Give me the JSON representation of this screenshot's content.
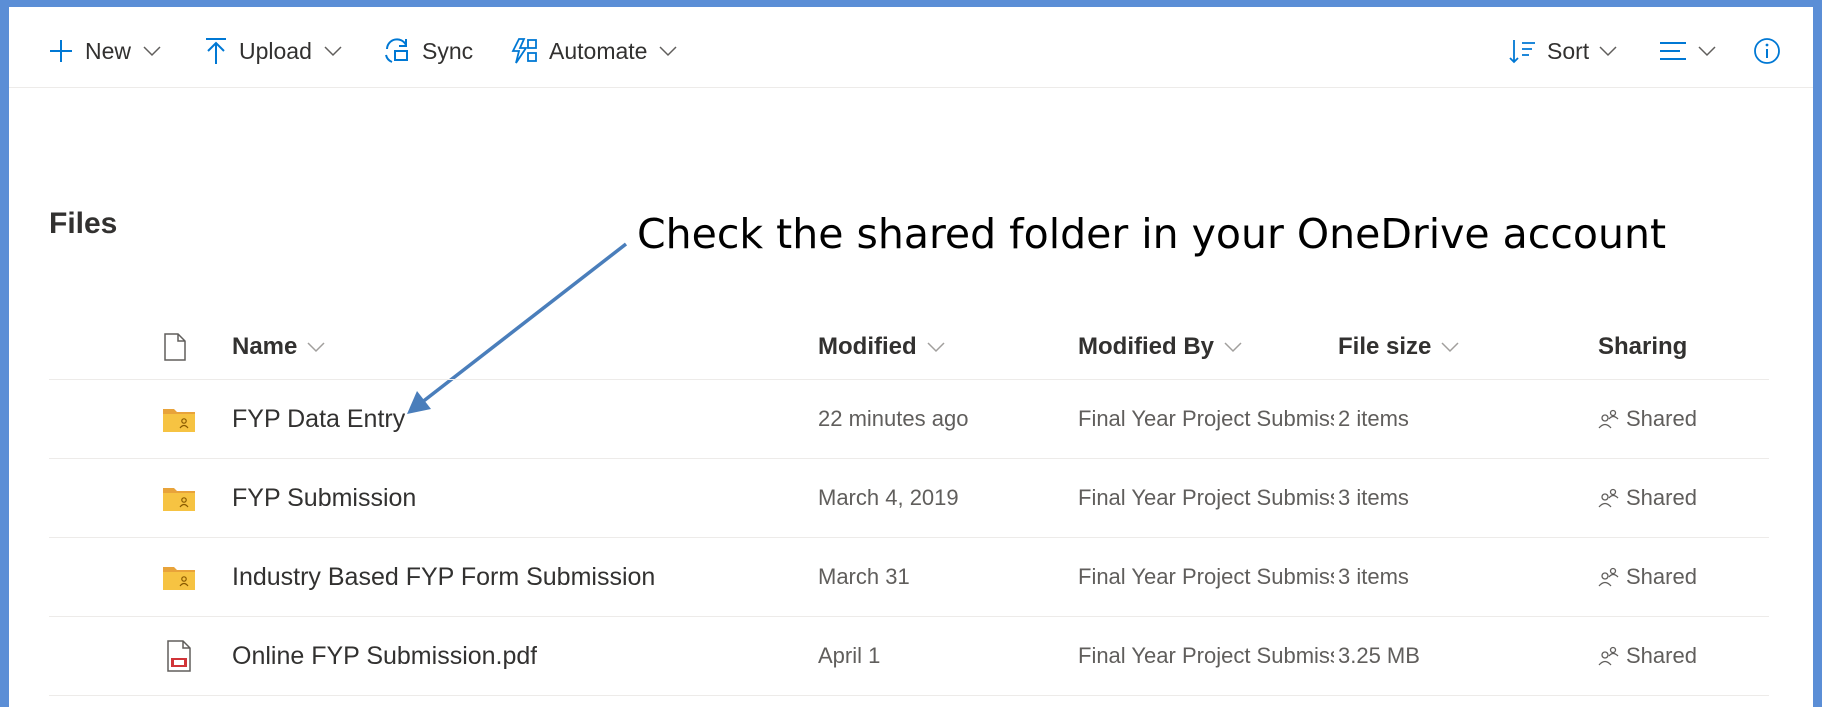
{
  "toolbar": {
    "new_label": "New",
    "upload_label": "Upload",
    "sync_label": "Sync",
    "automate_label": "Automate",
    "sort_label": "Sort"
  },
  "page": {
    "title": "Files",
    "annotation": "Check the shared folder in your OneDrive account"
  },
  "columns": {
    "name": "Name",
    "modified": "Modified",
    "modified_by": "Modified By",
    "file_size": "File size",
    "sharing": "Sharing"
  },
  "files": [
    {
      "type": "shared-folder",
      "name": "FYP Data Entry",
      "modified": "22 minutes ago",
      "modified_by": "Final Year Project Submissi",
      "size": "2 items",
      "sharing": "Shared",
      "new": true
    },
    {
      "type": "shared-folder",
      "name": "FYP Submission",
      "modified": "March 4, 2019",
      "modified_by": "Final Year Project Submissi",
      "size": "3 items",
      "sharing": "Shared",
      "new": false
    },
    {
      "type": "shared-folder",
      "name": "Industry Based FYP Form Submission",
      "modified": "March 31",
      "modified_by": "Final Year Project Submissi",
      "size": "3 items",
      "sharing": "Shared",
      "new": false
    },
    {
      "type": "pdf",
      "name": "Online FYP Submission.pdf",
      "modified": "April 1",
      "modified_by": "Final Year Project Submissi",
      "size": "3.25 MB",
      "sharing": "Shared",
      "new": false
    }
  ],
  "colors": {
    "accent": "#0078d4",
    "folder": "#f6c342",
    "arrow": "#4a7ebb",
    "frame_border": "#5b8ed6"
  }
}
